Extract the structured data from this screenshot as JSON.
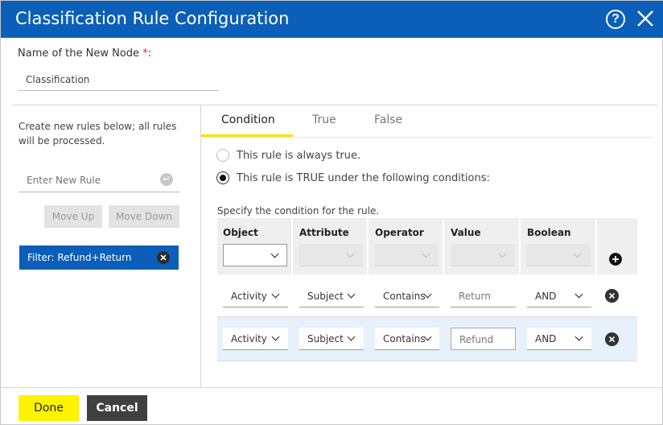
{
  "dialog": {
    "title": "Classification Rule Configuration",
    "help_icon": "help-circle-icon",
    "close_icon": "close-icon"
  },
  "node": {
    "label": "Name of the New Node",
    "required_mark": "*",
    "label_suffix": ":",
    "value": "Classification"
  },
  "left_panel": {
    "hint": "Create new rules below; all rules will be processed.",
    "new_rule_placeholder": "Enter New Rule",
    "enter_icon": "enter-icon",
    "move_up": "Move Up",
    "move_down": "Move Down",
    "rules": [
      {
        "label": "Filter: Refund+Return",
        "selected": true
      }
    ]
  },
  "tabs": [
    {
      "label": "Condition",
      "active": true
    },
    {
      "label": "True",
      "active": false
    },
    {
      "label": "False",
      "active": false
    }
  ],
  "condition": {
    "option_always": "This rule is always true.",
    "option_conditions": "This rule is TRUE under the following conditions:",
    "selected_option": "conditions",
    "spec_text": "Specify the condition for the rule.",
    "columns": [
      "Object",
      "Attribute",
      "Operator",
      "Value",
      "Boolean"
    ],
    "new_row": {
      "object": "",
      "attribute": "",
      "operator": "",
      "value": "",
      "boolean": ""
    },
    "rows": [
      {
        "object": "Activity",
        "attribute": "Subject",
        "operator": "Contains",
        "value": "Return",
        "boolean": "AND",
        "highlighted": false
      },
      {
        "object": "Activity",
        "attribute": "Subject",
        "operator": "Contains",
        "value": "Refund",
        "boolean": "AND",
        "highlighted": true
      }
    ]
  },
  "footer": {
    "done": "Done",
    "cancel": "Cancel"
  },
  "colors": {
    "titlebar": "#0b5fb8",
    "accent_yellow": "#fff200",
    "cancel_bg": "#404040",
    "selected_row": "#e6f1fb"
  }
}
